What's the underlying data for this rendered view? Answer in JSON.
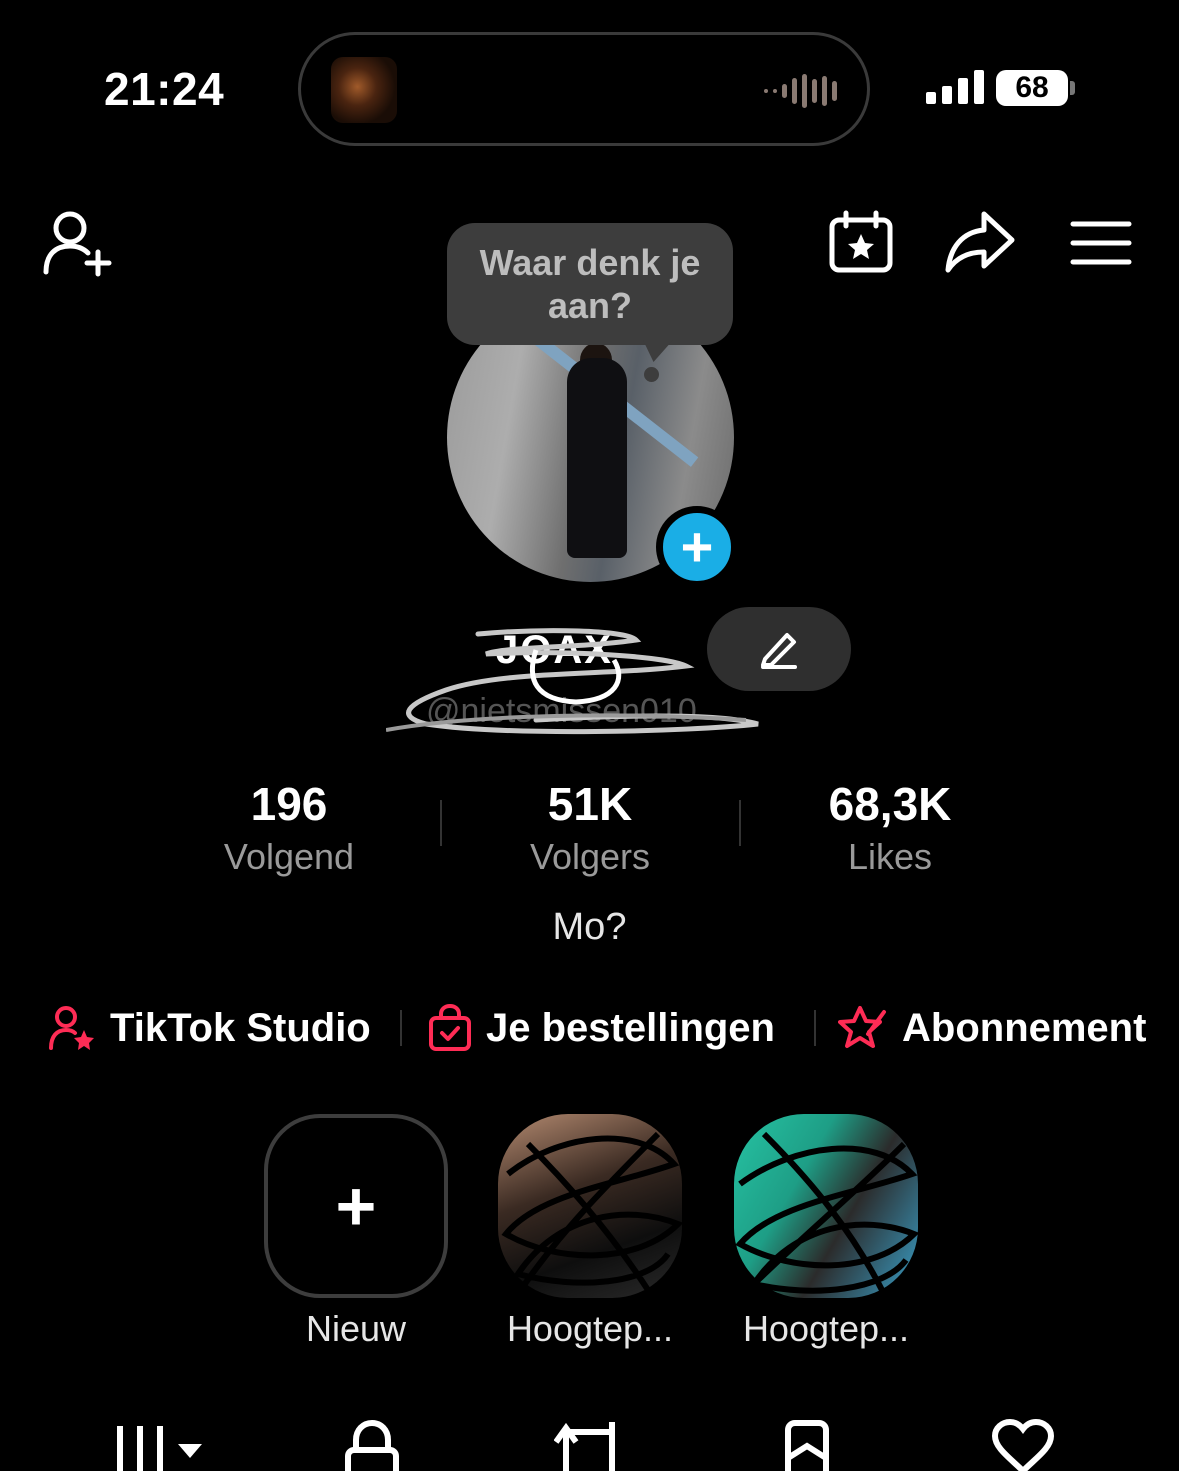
{
  "status_bar": {
    "time": "21:24",
    "battery": "68"
  },
  "header": {
    "icons": [
      "add-friend-icon",
      "calendar-star-icon",
      "share-icon",
      "menu-icon"
    ]
  },
  "tooltip": {
    "text": "Waar denk je aan?"
  },
  "profile": {
    "name": "JOAX",
    "handle": "@nietsmissen010"
  },
  "stats": [
    {
      "value": "196",
      "label": "Volgend"
    },
    {
      "value": "51K",
      "label": "Volgers"
    },
    {
      "value": "68,3K",
      "label": "Likes"
    }
  ],
  "bio": "Mo?",
  "links": [
    {
      "label": "TikTok Studio",
      "icon": "creator-star-icon"
    },
    {
      "label": "Je bestellingen",
      "icon": "shopping-bag-icon"
    },
    {
      "label": "Abonnement",
      "icon": "subscription-star-icon"
    }
  ],
  "highlights": [
    {
      "label": "Nieuw"
    },
    {
      "label": "Hoogtep..."
    },
    {
      "label": "Hoogtep..."
    }
  ],
  "tabs": [
    "videos-grid-icon",
    "private-lock-icon",
    "reposts-icon",
    "saved-bookmark-icon",
    "liked-heart-icon"
  ],
  "colors": {
    "background": "#000000",
    "accent_red": "#fe2c55",
    "accent_blue": "#1aaee6",
    "muted_text": "#9a9a9a"
  }
}
